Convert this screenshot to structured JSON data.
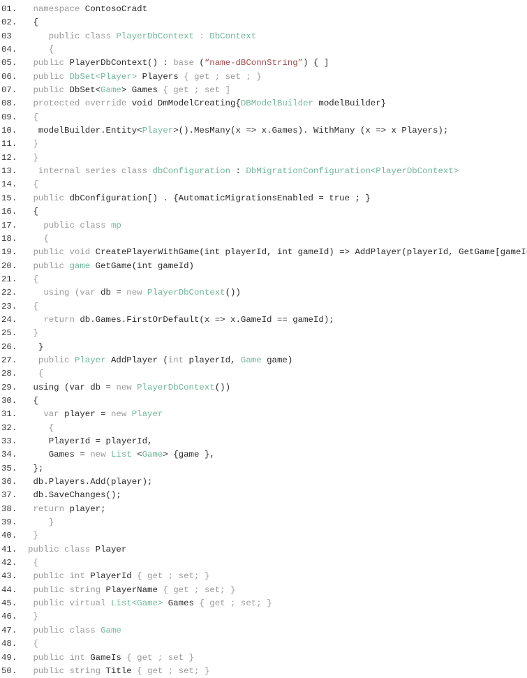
{
  "document": {
    "language": "C#",
    "colors": {
      "keyword": "#9a9a9a",
      "type": "#6fb79a",
      "string": "#a04a4a",
      "plain": "#2a2a2a"
    },
    "lines": [
      {
        "num": "01.",
        "indent": "",
        "tokens": [
          [
            "kw",
            "namespace "
          ],
          [
            "pl",
            "ContosoCradt"
          ]
        ]
      },
      {
        "num": "02.",
        "indent": "",
        "tokens": [
          [
            "pl",
            "{"
          ]
        ]
      },
      {
        "num": "03 ",
        "indent": "  ",
        "tokens": [
          [
            "kw",
            "public class "
          ],
          [
            "ty",
            "PlayerDbContext"
          ],
          [
            "kw",
            " : "
          ],
          [
            "ty",
            "DbContext"
          ]
        ]
      },
      {
        "num": "04.",
        "indent": "  ",
        "tokens": [
          [
            "kw",
            "{"
          ]
        ]
      },
      {
        "num": "05.",
        "indent": "",
        "tokens": [
          [
            "kw",
            "public "
          ],
          [
            "pl",
            "PlayerDbContext() : "
          ],
          [
            "kw",
            "base "
          ],
          [
            "pl",
            "("
          ],
          [
            "str",
            "“name-dBConnString”"
          ],
          [
            "pl",
            ") { ]"
          ]
        ]
      },
      {
        "num": "06.",
        "indent": "",
        "tokens": [
          [
            "kw",
            "public "
          ],
          [
            "ty",
            "DbSet<Player>"
          ],
          [
            "pl",
            " Players "
          ],
          [
            "kw",
            "{ get ; set ; }"
          ]
        ]
      },
      {
        "num": "07.",
        "indent": "",
        "tokens": [
          [
            "kw",
            "public "
          ],
          [
            "pl",
            "DbSet<"
          ],
          [
            "ty",
            "Game"
          ],
          [
            "pl",
            "> Games "
          ],
          [
            "kw",
            "{ get ; set ]"
          ]
        ]
      },
      {
        "num": "08.",
        "indent": "",
        "tokens": [
          [
            "kw",
            "protected override "
          ],
          [
            "pl",
            "void DmModelCreating{"
          ],
          [
            "ty",
            "DBModelBuilder"
          ],
          [
            "pl",
            " modelBuilder}"
          ]
        ]
      },
      {
        "num": "09.",
        "indent": "",
        "tokens": [
          [
            "kw",
            "{"
          ]
        ]
      },
      {
        "num": "10.",
        "indent": " ",
        "tokens": [
          [
            "pl",
            "modelBuilder.Entity<"
          ],
          [
            "ty",
            "Player"
          ],
          [
            "pl",
            ">().MesMany(x => x.Games). WithMany (x => x Players);"
          ]
        ]
      },
      {
        "num": "11.",
        "indent": "",
        "tokens": [
          [
            "kw",
            "}"
          ]
        ]
      },
      {
        "num": "12.",
        "indent": "",
        "tokens": [
          [
            "kw",
            "}"
          ]
        ]
      },
      {
        "num": "13.",
        "indent": " ",
        "tokens": [
          [
            "kw",
            "internal series class "
          ],
          [
            "ty",
            "dbConfiguration"
          ],
          [
            "pl",
            " : "
          ],
          [
            "ty",
            "DbMigrationConfiguration<PlayerDbContext>"
          ]
        ]
      },
      {
        "num": "14.",
        "indent": "",
        "tokens": [
          [
            "kw",
            "{"
          ]
        ]
      },
      {
        "num": "15.",
        "indent": "",
        "tokens": [
          [
            "kw",
            "public "
          ],
          [
            "pl",
            "dbConfiguration[) . {AutomaticMigrationsEnabled = true ; }"
          ]
        ]
      },
      {
        "num": "16.",
        "indent": "",
        "tokens": [
          [
            "pl",
            "{"
          ]
        ]
      },
      {
        "num": "17.",
        "indent": "  ",
        "tokens": [
          [
            "kw",
            "public class "
          ],
          [
            "ty",
            "mp"
          ]
        ]
      },
      {
        "num": "18.",
        "indent": "  ",
        "tokens": [
          [
            "kw",
            "{"
          ]
        ]
      },
      {
        "num": "19.",
        "indent": "",
        "tokens": [
          [
            "kw",
            "public void "
          ],
          [
            "pl",
            "CreatePlayerWithGame(int playerId, int gameId) => AddPlayer(playerId, GetGame[gameId));"
          ]
        ]
      },
      {
        "num": "20.",
        "indent": "",
        "tokens": [
          [
            "kw",
            "public "
          ],
          [
            "ty",
            "game"
          ],
          [
            "pl",
            " GetGame(int gameId)"
          ]
        ]
      },
      {
        "num": "21.",
        "indent": "",
        "tokens": [
          [
            "kw",
            "{"
          ]
        ]
      },
      {
        "num": "22.",
        "indent": "  ",
        "tokens": [
          [
            "kw",
            "using (var "
          ],
          [
            "pl",
            "db = "
          ],
          [
            "kw",
            "new "
          ],
          [
            "ty",
            "PlayerDbContext"
          ],
          [
            "pl",
            "())"
          ]
        ]
      },
      {
        "num": "23.",
        "indent": "",
        "tokens": [
          [
            "kw",
            "{"
          ]
        ]
      },
      {
        "num": "24.",
        "indent": "  ",
        "tokens": [
          [
            "kw",
            "return "
          ],
          [
            "pl",
            "db.Games.FirstOrDefault(x => x.GameId == gameId);"
          ]
        ]
      },
      {
        "num": "25.",
        "indent": "",
        "tokens": [
          [
            "kw",
            "}"
          ]
        ]
      },
      {
        "num": "26.",
        "indent": " ",
        "tokens": [
          [
            "pl",
            "}"
          ]
        ]
      },
      {
        "num": "27.",
        "indent": " ",
        "tokens": [
          [
            "kw",
            "public "
          ],
          [
            "ty",
            "Player"
          ],
          [
            "pl",
            " AddPlayer ("
          ],
          [
            "kw",
            "int "
          ],
          [
            "pl",
            "playerId, "
          ],
          [
            "ty",
            "Game"
          ],
          [
            "pl",
            " game)"
          ]
        ]
      },
      {
        "num": "28.",
        "indent": " ",
        "tokens": [
          [
            "kw",
            "{"
          ]
        ]
      },
      {
        "num": "29.",
        "indent": "",
        "tokens": [
          [
            "pl",
            "using (var db = "
          ],
          [
            "kw",
            "new "
          ],
          [
            "ty",
            "PlayerDbContext"
          ],
          [
            "pl",
            "())"
          ]
        ]
      },
      {
        "num": "30.",
        "indent": "",
        "tokens": [
          [
            "pl",
            "{"
          ]
        ]
      },
      {
        "num": "31.",
        "indent": "  ",
        "tokens": [
          [
            "kw",
            "var "
          ],
          [
            "pl",
            "player = "
          ],
          [
            "kw",
            "new "
          ],
          [
            "ty",
            "Player"
          ]
        ]
      },
      {
        "num": "32.",
        "indent": "   ",
        "tokens": [
          [
            "kw",
            "{"
          ]
        ]
      },
      {
        "num": "33.",
        "indent": "   ",
        "tokens": [
          [
            "pl",
            "PlayerId = playerId,"
          ]
        ]
      },
      {
        "num": "34.",
        "indent": "   ",
        "tokens": [
          [
            "pl",
            "Games = "
          ],
          [
            "kw",
            "new "
          ],
          [
            "ty",
            "List"
          ],
          [
            "pl",
            " <"
          ],
          [
            "ty",
            "Game"
          ],
          [
            "pl",
            "> {game },"
          ]
        ]
      },
      {
        "num": "35.",
        "indent": "",
        "tokens": [
          [
            "pl",
            "};"
          ]
        ]
      },
      {
        "num": "36.",
        "indent": "",
        "tokens": [
          [
            "pl",
            "db.Players.Add(player);"
          ]
        ]
      },
      {
        "num": "37.",
        "indent": "",
        "tokens": [
          [
            "pl",
            "db.SaveChanges();"
          ]
        ]
      },
      {
        "num": "38.",
        "indent": "",
        "tokens": [
          [
            "kw",
            "return "
          ],
          [
            "pl",
            "player;"
          ]
        ]
      },
      {
        "num": "39.",
        "indent": "   ",
        "tokens": [
          [
            "kw",
            "}"
          ]
        ]
      },
      {
        "num": "40.",
        "indent": "",
        "tokens": [
          [
            "kw",
            "}"
          ]
        ]
      },
      {
        "num": "41.",
        "indent": "",
        "tokens": [
          [
            "kw",
            "public class "
          ],
          [
            "pl",
            "Player"
          ]
        ]
      },
      {
        "num": "42.",
        "indent": "",
        "tokens": [
          [
            "kw",
            "{"
          ]
        ]
      },
      {
        "num": "43.",
        "indent": "",
        "tokens": [
          [
            "kw",
            "public int "
          ],
          [
            "pl",
            "PlayerId "
          ],
          [
            "kw",
            "{ get ; set; }"
          ]
        ]
      },
      {
        "num": "44.",
        "indent": "",
        "tokens": [
          [
            "kw",
            "public string "
          ],
          [
            "pl",
            "PlayerName "
          ],
          [
            "kw",
            "{ get ; set; }"
          ]
        ]
      },
      {
        "num": "45.",
        "indent": "",
        "tokens": [
          [
            "kw",
            "public virtual "
          ],
          [
            "ty",
            "List<Game>"
          ],
          [
            "pl",
            " Games "
          ],
          [
            "kw",
            "{ get ; set; }"
          ]
        ]
      },
      {
        "num": "46.",
        "indent": "",
        "tokens": [
          [
            "kw",
            "}"
          ]
        ]
      },
      {
        "num": "47.",
        "indent": "",
        "tokens": [
          [
            "kw",
            "public class "
          ],
          [
            "ty",
            "Game"
          ]
        ]
      },
      {
        "num": "48.",
        "indent": "",
        "tokens": [
          [
            "kw",
            "{"
          ]
        ]
      },
      {
        "num": "49.",
        "indent": "",
        "tokens": [
          [
            "kw",
            "public int "
          ],
          [
            "pl",
            "GameIs "
          ],
          [
            "kw",
            "{ get ; set }"
          ]
        ]
      },
      {
        "num": "50.",
        "indent": "",
        "tokens": [
          [
            "kw",
            "public string "
          ],
          [
            "pl",
            "Title "
          ],
          [
            "kw",
            "{ get ; set; }"
          ]
        ]
      }
    ]
  }
}
